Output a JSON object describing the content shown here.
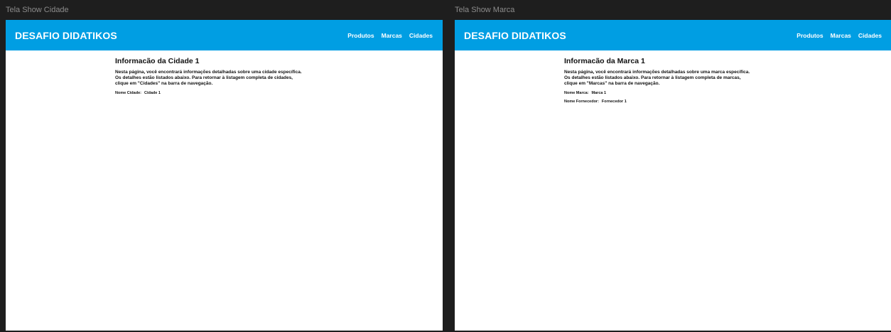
{
  "frames": [
    {
      "label": "Tela Show Cidade",
      "brand": "DESAFIO DIDATIKOS",
      "nav": [
        "Produtos",
        "Marcas",
        "Cidades"
      ],
      "title": "Informacão da Cidade 1",
      "description": [
        "Nesta página, você encontrará informações detalhadas sobre uma cidade específica.",
        "Os detalhes estão listados abaixo. Para retornar à listagem completa de cidades,",
        "clique em \"Cidades\" na barra de navegação."
      ],
      "fields": [
        {
          "label": "Nome Cidade:",
          "value": "Cidade 1"
        }
      ]
    },
    {
      "label": "Tela Show Marca",
      "brand": "DESAFIO DIDATIKOS",
      "nav": [
        "Produtos",
        "Marcas",
        "Cidades"
      ],
      "title": "Informacão da Marca 1",
      "description": [
        "Nesta página, você encontrará informações detalhadas sobre uma marca específica.",
        "Os detalhes estão listados abaixo. Para retornar à listagem completa de marcas,",
        "clique em \"Marcas\" na barra de navegação."
      ],
      "fields": [
        {
          "label": "Nome Marca:",
          "value": "Marca 1"
        },
        {
          "label": "Nome Fornecedor:",
          "value": "Fornecedor 1"
        }
      ]
    }
  ]
}
